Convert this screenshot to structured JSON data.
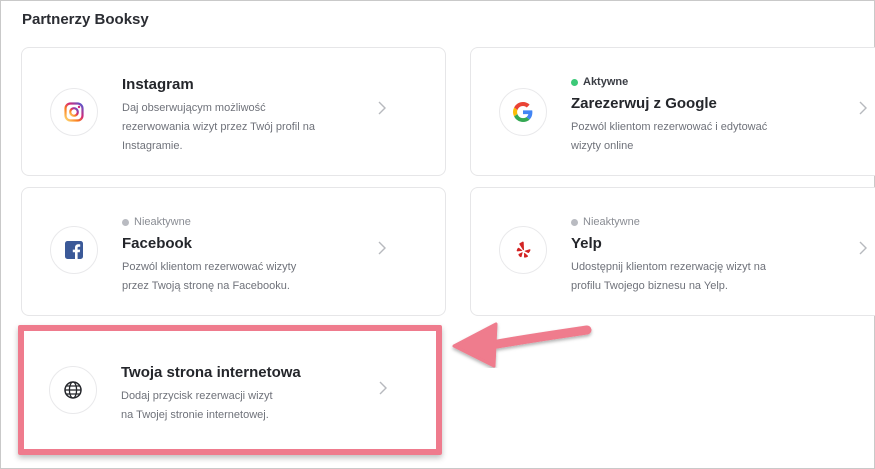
{
  "section": {
    "title": "Partnerzy Booksy"
  },
  "cards": [
    {
      "title": "Instagram",
      "status": "",
      "description": [
        "Daj obserwującym możliwość",
        "rezerwowania wizyt przez Twój profil na",
        "Instagramie."
      ]
    },
    {
      "title": "Zarezerwuj z Google",
      "status": "Aktywne",
      "description": [
        "Pozwól klientom rezerwować i edytować",
        "wizyty online"
      ]
    },
    {
      "title": "Facebook",
      "status": "Nieaktywne",
      "description": [
        "Pozwól klientom rezerwować wizyty",
        "przez Twoją stronę na Facebooku."
      ]
    },
    {
      "title": "Yelp",
      "status": "Nieaktywne",
      "description": [
        "Udostępnij klientom rezerwację wizyt na",
        "profilu Twojego biznesu na Yelp."
      ]
    },
    {
      "title": "Twoja strona internetowa",
      "status": "",
      "description": [
        "Dodaj przycisk rezerwacji wizyt",
        "na Twojej stronie internetowej."
      ]
    }
  ],
  "colors": {
    "active_dot": "#3cc978",
    "inactive_dot": "#b9bbc1",
    "highlight": "#ef7b8d",
    "instagram": "#d6249f",
    "facebook": "#3b5998",
    "yelp": "#d32323"
  },
  "icons": {
    "instagram": "instagram-icon",
    "google": "google-icon",
    "facebook": "facebook-icon",
    "yelp": "yelp-icon",
    "website": "globe-icon",
    "chevron": "chevron-right-icon"
  }
}
